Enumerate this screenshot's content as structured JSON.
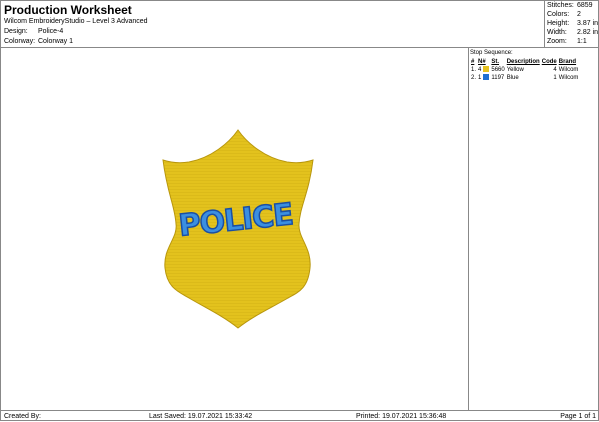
{
  "header": {
    "title": "Production Worksheet",
    "software": "Wilcom EmbroideryStudio – Level 3 Advanced",
    "design_label": "Design:",
    "design_value": "Police-4",
    "colorway_label": "Colorway:",
    "colorway_value": "Colorway 1"
  },
  "stats": {
    "stitches_label": "Stitches:",
    "stitches": "6859",
    "colors_label": "Colors:",
    "colors": "2",
    "height_label": "Height:",
    "height": "3.87 in",
    "width_label": "Width:",
    "width": "2.82 in",
    "zoom_label": "Zoom:",
    "zoom": "1:1"
  },
  "stop_sequence": {
    "title": "Stop Sequence:",
    "columns": [
      "#",
      "N#",
      "St.",
      "Description",
      "Code",
      "Brand"
    ],
    "rows": [
      {
        "num": "1.",
        "n": "4",
        "st": "5660",
        "desc": "Yellow",
        "code": "4",
        "brand": "Wilcom",
        "color": "#e6c21f"
      },
      {
        "num": "2.",
        "n": "1",
        "st": "1197",
        "desc": "Blue",
        "code": "1",
        "brand": "Wilcom",
        "color": "#1f6fd1"
      }
    ]
  },
  "design": {
    "badge_text": "POLICE",
    "badge_color": "#e3c21d",
    "text_color": "#3b8fe0",
    "outline_color": "#1a4fa3"
  },
  "footer": {
    "created_by": "Created By:",
    "last_saved": "Last Saved: 19.07.2021 15:33:42",
    "printed": "Printed: 19.07.2021 15:36:48",
    "page": "Page 1 of 1"
  }
}
